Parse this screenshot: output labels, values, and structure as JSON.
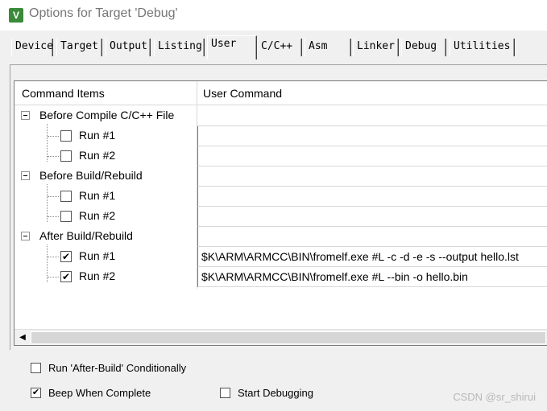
{
  "window": {
    "title": "Options for Target 'Debug'",
    "icon": "uvision-icon"
  },
  "tabs": [
    {
      "label": "Device"
    },
    {
      "label": "Target"
    },
    {
      "label": "Output"
    },
    {
      "label": "Listing"
    },
    {
      "label": "User",
      "active": true
    },
    {
      "label": "C/C++"
    },
    {
      "label": "Asm"
    },
    {
      "label": "Linker"
    },
    {
      "label": "Debug"
    },
    {
      "label": "Utilities"
    }
  ],
  "table": {
    "headers": [
      "Command Items",
      "User Command"
    ],
    "groups": [
      {
        "label": "Before Compile C/C++ File",
        "items": [
          {
            "label": "Run #1",
            "checked": false,
            "command": ""
          },
          {
            "label": "Run #2",
            "checked": false,
            "command": ""
          }
        ]
      },
      {
        "label": "Before Build/Rebuild",
        "items": [
          {
            "label": "Run #1",
            "checked": false,
            "command": ""
          },
          {
            "label": "Run #2",
            "checked": false,
            "command": ""
          }
        ]
      },
      {
        "label": "After Build/Rebuild",
        "items": [
          {
            "label": "Run #1",
            "checked": true,
            "command": "$K\\ARM\\ARMCC\\BIN\\fromelf.exe #L -c -d -e -s --output hello.lst"
          },
          {
            "label": "Run #2",
            "checked": true,
            "command": "$K\\ARM\\ARMCC\\BIN\\fromelf.exe #L --bin -o hello.bin"
          }
        ]
      }
    ]
  },
  "options": {
    "run_after_build": {
      "label": "Run 'After-Build' Conditionally",
      "checked": false
    },
    "beep_when_complete": {
      "label": "Beep When Complete",
      "checked": true
    },
    "start_debugging": {
      "label": "Start Debugging",
      "checked": false
    }
  },
  "watermark": "CSDN @sr_shirui",
  "colors": {
    "window_bg": "#f0f0f0",
    "table_bg": "#ffffff",
    "icon_green": "#3a8a3a"
  }
}
